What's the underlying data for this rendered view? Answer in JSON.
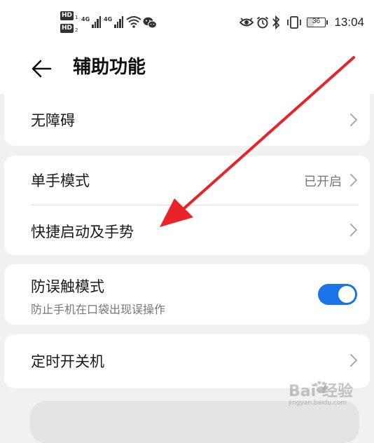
{
  "status_bar": {
    "hd_badge": "HD",
    "hd_sub_1": "1",
    "hd_sub_2": "2",
    "network_1": "4G",
    "network_2": "4G",
    "battery_level": "36",
    "time": "13:04",
    "icons": [
      "eye-icon",
      "alarm-icon",
      "bluetooth-icon",
      "vibrate-icon",
      "wifi-icon",
      "wechat-icon"
    ]
  },
  "header": {
    "title": "辅助功能",
    "back_icon": "back-arrow-icon"
  },
  "groups": [
    {
      "items": [
        {
          "label": "无障碍",
          "value": ""
        }
      ]
    },
    {
      "items": [
        {
          "label": "单手模式",
          "value": "已开启"
        },
        {
          "label": "快捷启动及手势",
          "value": ""
        }
      ]
    },
    {
      "items": [
        {
          "label": "防误触模式",
          "sublabel": "防止手机在口袋出现误操作",
          "toggle_on": true
        }
      ]
    },
    {
      "items": [
        {
          "label": "定时开关机",
          "value": ""
        }
      ]
    }
  ],
  "watermark": {
    "main": "Bai  经验",
    "sub": "jingyan.baidu.com"
  },
  "colors": {
    "accent": "#1a73e8",
    "annotation_arrow": "#e8232a",
    "page_bg": "#f1f1f1"
  }
}
